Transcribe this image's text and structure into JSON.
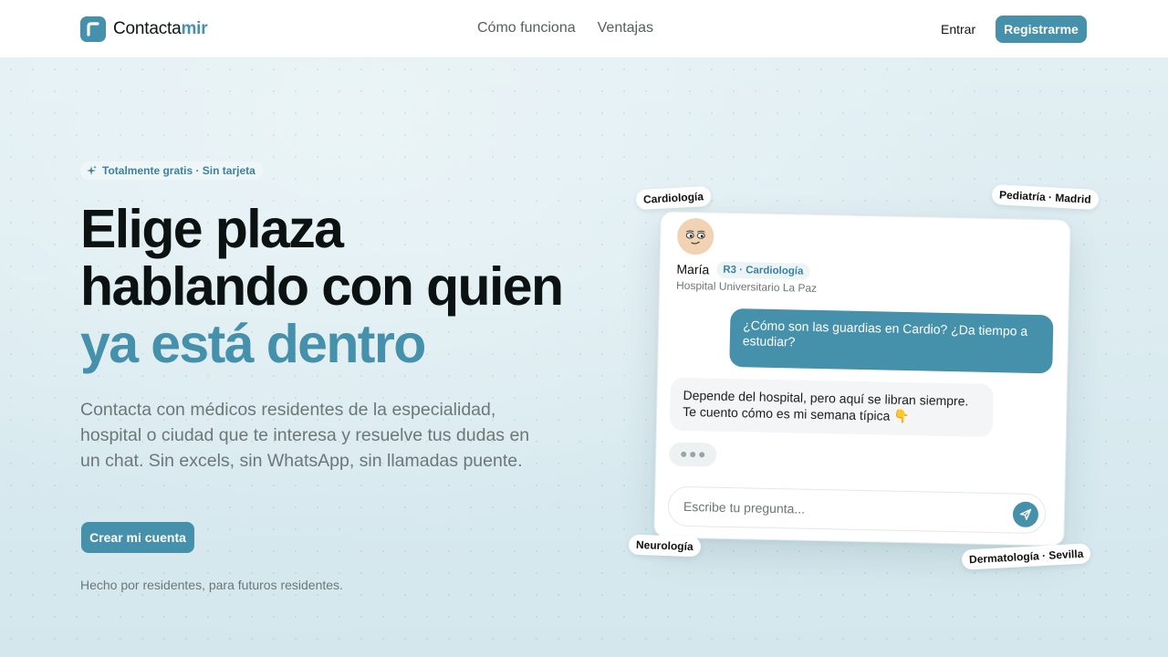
{
  "nav": {
    "brand_part1": "Contacta",
    "brand_part2": "mir",
    "links": [
      "Cómo funciona",
      "Ventajas"
    ],
    "login": "Entrar",
    "register": "Registrarme"
  },
  "hero": {
    "badge": "Totalmente gratis · Sin tarjeta",
    "headline_line1": "Elige plaza",
    "headline_line2": "hablando con quien",
    "headline_line3": "ya está dentro",
    "lede": "Contacta con médicos residentes de la especialidad, hospital o ciudad que te interesa y resuelve tus dudas en un chat. Sin excels, sin WhatsApp, sin llamadas puente.",
    "cta": "Crear mi cuenta",
    "footnote": "Hecho por residentes, para futuros residentes."
  },
  "chat": {
    "name": "María",
    "role": "R3 · Cardiología",
    "hospital": "Hospital Universitario La Paz",
    "outgoing": "¿Cómo son las guardias en Cardio? ¿Da tiempo a estudiar?",
    "incoming": "Depende del hospital, pero aquí se libran siempre. Te cuento cómo es mi semana típica 👇",
    "input_placeholder": "Escribe tu pregunta..."
  },
  "tags": {
    "cardiologia": "Cardiología",
    "pediatria": "Pediatría · Madrid",
    "neurologia": "Neurología",
    "dermatologia": "Dermatología · Sevilla"
  },
  "colors": {
    "accent": "#4590ab",
    "text_dark": "#0c1112",
    "text_muted": "#6d7777"
  },
  "icons": {
    "logo": "brand-logo-icon",
    "badge": "sparkle-icon",
    "send": "send-icon",
    "typing": "typing-indicator"
  }
}
